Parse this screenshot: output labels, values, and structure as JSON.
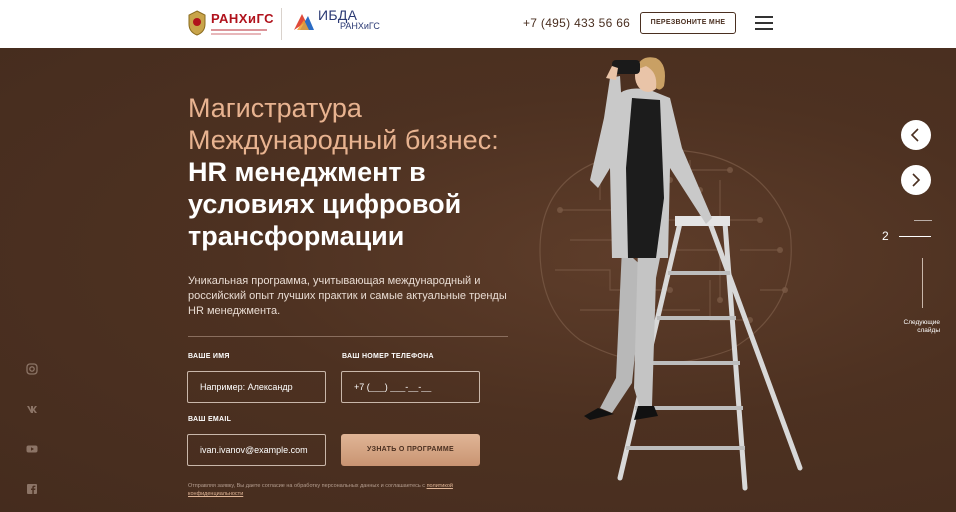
{
  "header": {
    "logo_main": "РАНХиГС",
    "logo2_main": "ИБДА",
    "logo2_sub": "РАНХиГС",
    "phone": "+7 (495) 433 56 66",
    "callback_label": "ПЕРЕЗВОНИТЕ МНЕ",
    "menu_icon": "hamburger-icon"
  },
  "hero": {
    "title_line1": "Магистратура",
    "title_line2": "Международный бизнес:",
    "subtitle": "HR менеджмент в условиях цифровой трансформации",
    "description": "Уникальная программа, учитывающая международный и российский опыт лучших практик и самые актуальные тренды HR менеджмента."
  },
  "form": {
    "name_label": "ВАШЕ ИМЯ",
    "name_placeholder": "Например: Александр",
    "phone_label": "ВАШ НОМЕР ТЕЛЕФОНА",
    "phone_value": "+7 (___) ___-__-__",
    "email_label": "ВАШ EMAIL",
    "email_placeholder": "ivan.ivanov@example.com",
    "submit_label": "УЗНАТЬ О ПРОГРАММЕ",
    "consent_text": "Отправляя заявку, Вы даете согласие на обработку персональных данных и соглашаетесь с ",
    "consent_link": "политикой конфиденциальности"
  },
  "social": [
    "instagram-icon",
    "vk-icon",
    "youtube-icon",
    "facebook-icon"
  ],
  "slider": {
    "current": "2",
    "next_label": "Следующие слайды"
  },
  "colors": {
    "brand_brown": "#4a2f20",
    "accent_peach": "#e0b596",
    "logo_red": "#b0121c",
    "logo_blue": "#2b3a74"
  }
}
